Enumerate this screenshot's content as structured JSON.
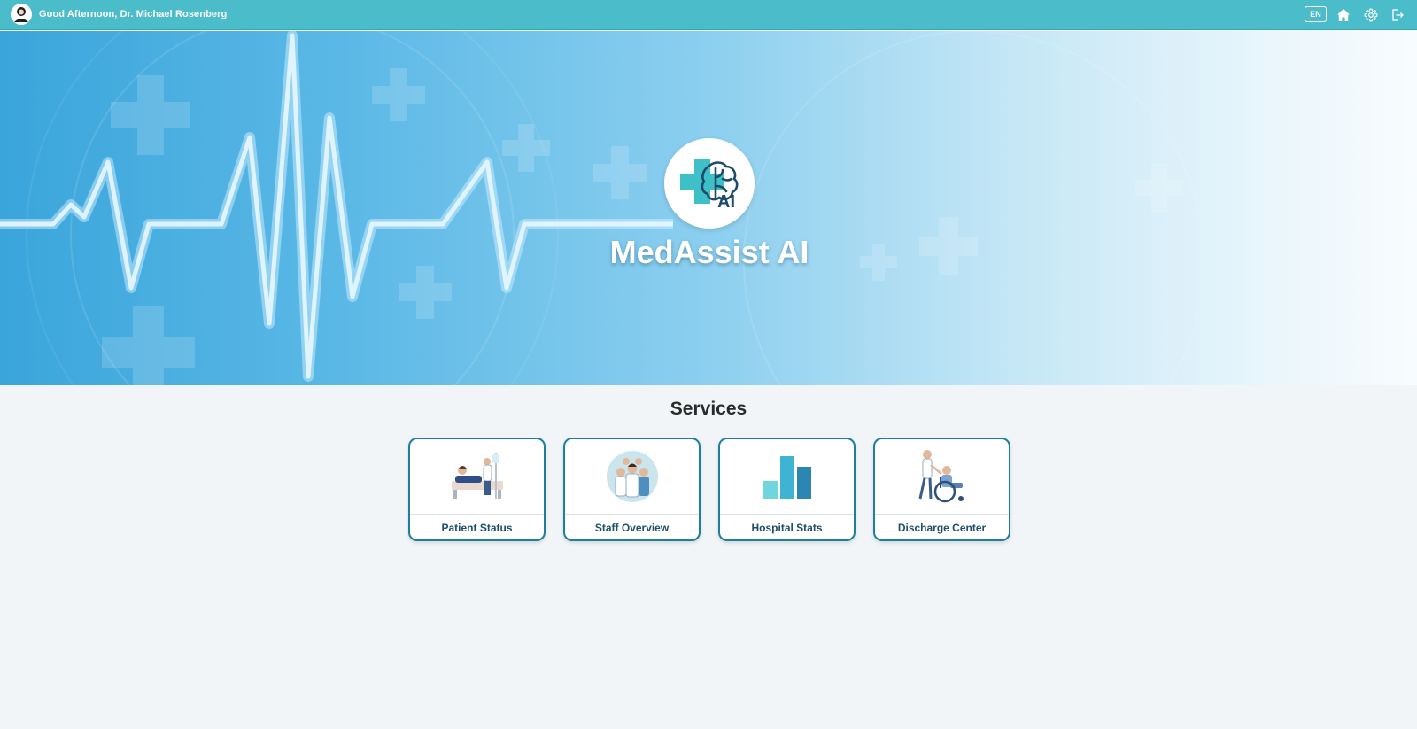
{
  "header": {
    "greeting": "Good Afternoon, Dr. Michael Rosenberg",
    "language": "EN",
    "icons": [
      "avatar-icon",
      "home-icon",
      "gear-icon",
      "logout-icon"
    ]
  },
  "hero": {
    "title": "MedAssist AI",
    "logo_text": "AI"
  },
  "services": {
    "title": "Services",
    "items": [
      {
        "label": "Patient Status",
        "icon": "patient-bed-icon"
      },
      {
        "label": "Staff Overview",
        "icon": "staff-group-icon"
      },
      {
        "label": "Hospital Stats",
        "icon": "bar-chart-icon"
      },
      {
        "label": "Discharge Center",
        "icon": "wheelchair-icon"
      }
    ]
  },
  "colors": {
    "topbar": "#4bbcc9",
    "card_border": "#1f7f99",
    "card_label": "#1c4f6b",
    "page_bg": "#f1f5f8"
  }
}
